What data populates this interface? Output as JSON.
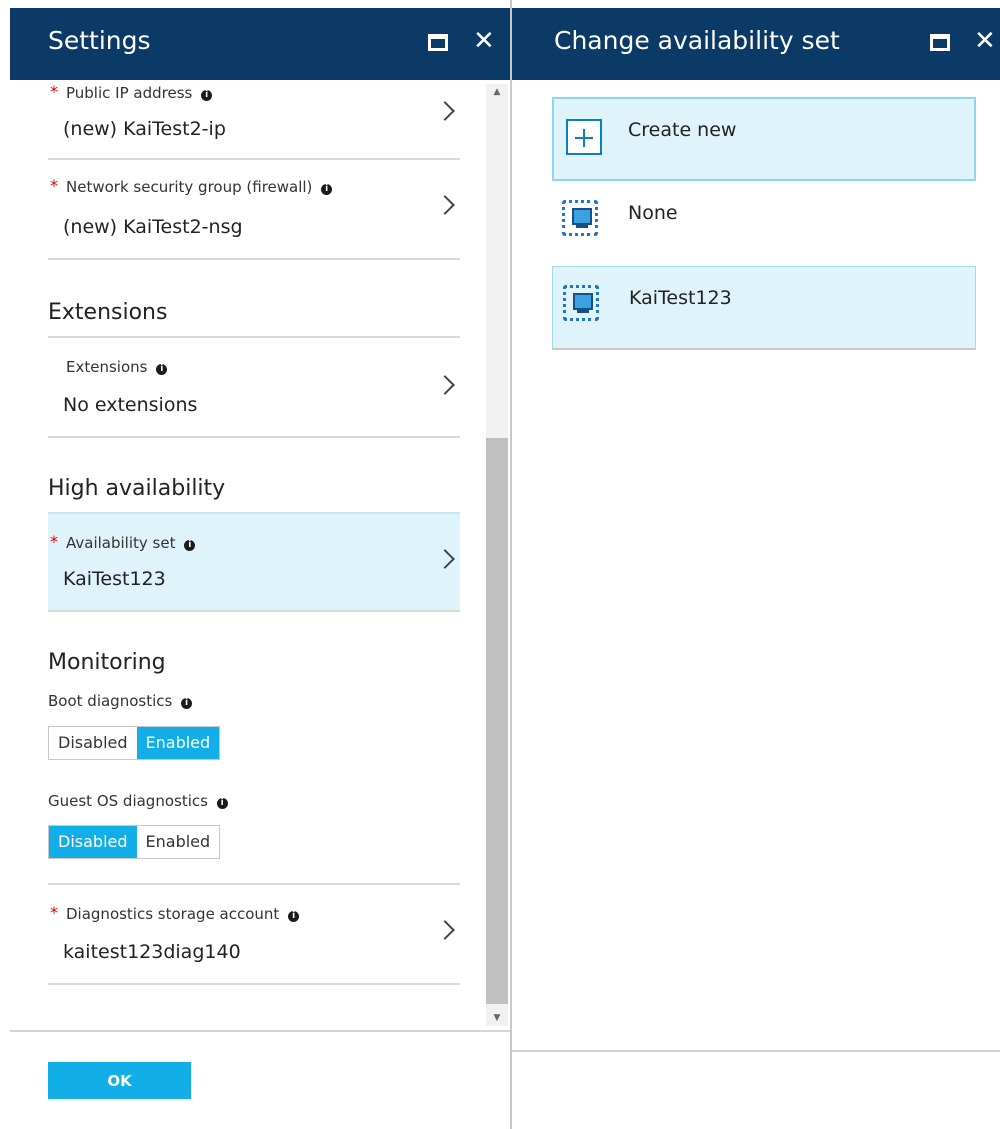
{
  "settings_blade": {
    "title": "Settings",
    "rows": [
      {
        "label": "Public IP address",
        "value": "(new) KaiTest2-ip",
        "required": true
      },
      {
        "label": "Network security group (firewall)",
        "value": "(new) KaiTest2-nsg",
        "required": true
      }
    ],
    "extensions": {
      "section_title": "Extensions",
      "label": "Extensions",
      "value": "No extensions"
    },
    "high_availability": {
      "section_title": "High availability",
      "label": "Availability set",
      "value": "KaiTest123"
    },
    "monitoring": {
      "section_title": "Monitoring",
      "boot_diagnostics": {
        "label": "Boot diagnostics",
        "options": [
          "Disabled",
          "Enabled"
        ],
        "selected": "Enabled"
      },
      "guest_os_diagnostics": {
        "label": "Guest OS diagnostics",
        "options": [
          "Disabled",
          "Enabled"
        ],
        "selected": "Disabled"
      },
      "storage": {
        "label": "Diagnostics storage account",
        "value": "kaitest123diag140"
      }
    },
    "ok_label": "OK"
  },
  "availability_blade": {
    "title": "Change availability set",
    "options": [
      {
        "label": "Create new",
        "icon": "plus-icon"
      },
      {
        "label": "None",
        "icon": "availability-set-icon"
      },
      {
        "label": "KaiTest123",
        "icon": "availability-set-icon"
      }
    ]
  },
  "icons": {
    "info": "i",
    "close": "✕",
    "required": "*"
  },
  "colors": {
    "header_bg": "#0b3a66",
    "accent": "#12aee8",
    "selected_bg": "#dff3fb",
    "required": "#e00000"
  }
}
